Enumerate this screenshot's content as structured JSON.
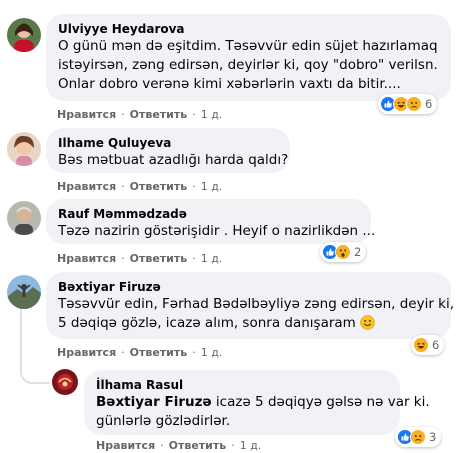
{
  "comments": [
    {
      "author": "Ulviyye Heydarova",
      "lines": [
        "O günü mən də eşitdim. Təsəvvür edin süjet hazırlamaq",
        "istəyirsən, zəng edirsən, deyirlər ki, qoy \"dobro\" verilsn.",
        "Onlar dobro verənə kimi xəbərlərin vaxtı da bitir...."
      ],
      "like_label": "Нравится",
      "reply_label": "Ответить",
      "time": "1 д.",
      "reaction_count": "6"
    },
    {
      "author": "Ilhame Quluyeva",
      "lines": [
        "Bəs mətbuat azadlığı harda qaldı?"
      ],
      "like_label": "Нравится",
      "reply_label": "Ответить",
      "time": "1 д."
    },
    {
      "author": "Rauf Məmmədzadə",
      "lines": [
        "Təzə nazirin göstərişidir . Heyif o nazirlikdən ..."
      ],
      "like_label": "Нравится",
      "reply_label": "Ответить",
      "time": "1 д.",
      "reaction_count": "2"
    },
    {
      "author": "Bəxtiyar Firuzə",
      "lines": [
        "Təsəvvür edin, Fərhad Bədəlbəyliyə zəng edirsən, deyir ki,",
        "5 dəqiqə gözlə, icazə alım, sonra danışaram"
      ],
      "like_label": "Нравится",
      "reply_label": "Ответить",
      "time": "1 д.",
      "reaction_count": "6"
    }
  ],
  "reply": {
    "author": "İlhama Rasul",
    "mention": "Bəxtiyar Firuzə",
    "line1_rest": " icazə 5 dəqiqyə gəlsə nə var ki.",
    "line2": "günlərlə gözlədirlər.",
    "like_label": "Нравится",
    "reply_label": "Ответить",
    "time": "1 д.",
    "reaction_count": "3"
  },
  "dot": "·",
  "colors": {
    "like_blue": "#1877f2",
    "haha_yellow": "#f7b125",
    "bubble_bg": "#f0f2f5",
    "meta_gray": "#65676b"
  }
}
